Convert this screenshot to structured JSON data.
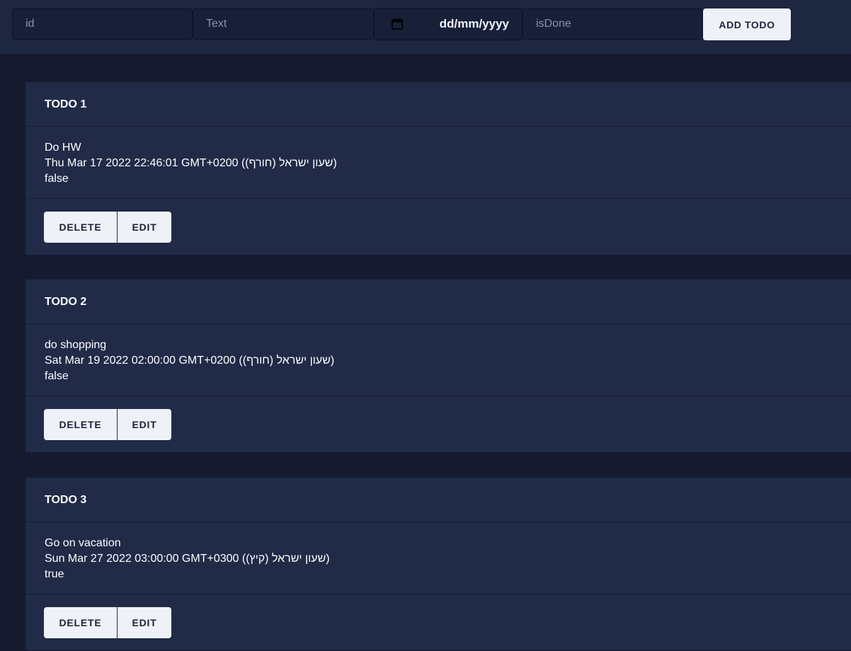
{
  "form": {
    "id_placeholder": "id",
    "text_placeholder": "Text",
    "date_placeholder": "dd/mm/yyyy",
    "date_icon": "calendar-icon",
    "isdone_placeholder": "isDone",
    "add_label": "ADD TODO"
  },
  "todos": [
    {
      "title": "TODO 1",
      "text": "Do HW",
      "date": "Thu Mar 17 2022 22:46:01 GMT+0200 (שעון ישראל (חורף))",
      "done": "false",
      "delete_label": "DELETE",
      "edit_label": "EDIT"
    },
    {
      "title": "TODO 2",
      "text": "do shopping",
      "date": "Sat Mar 19 2022 02:00:00 GMT+0200 (שעון ישראל (חורף))",
      "done": "false",
      "delete_label": "DELETE",
      "edit_label": "EDIT"
    },
    {
      "title": "TODO 3",
      "text": "Go on vacation",
      "date": "Sun Mar 27 2022 03:00:00 GMT+0300 (שעון ישראל (קיץ))",
      "done": "true",
      "delete_label": "DELETE",
      "edit_label": "EDIT"
    }
  ],
  "colors": {
    "background": "#151a2e",
    "topbar": "#1e2740",
    "card": "#212b47",
    "button": "#eef1f8"
  }
}
